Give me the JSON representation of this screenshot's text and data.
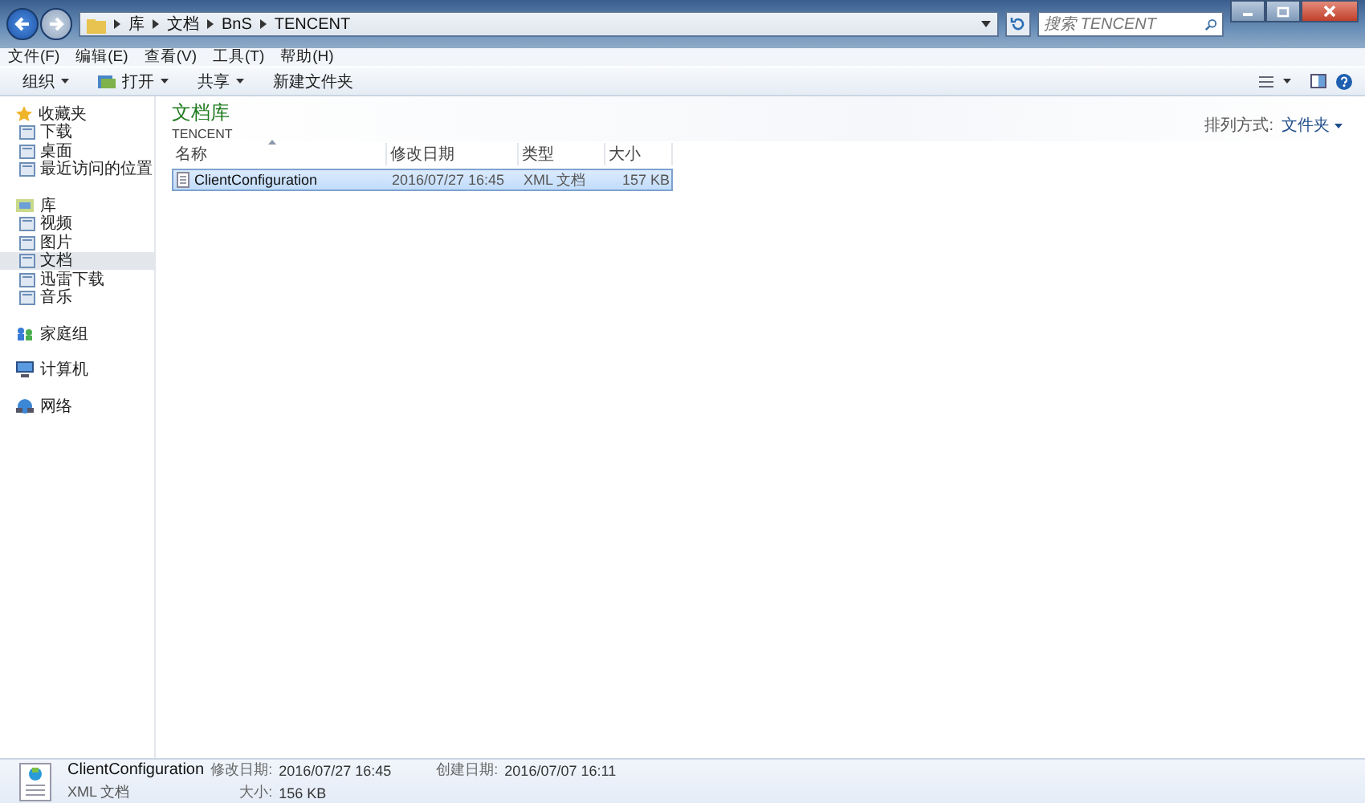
{
  "window": {
    "breadcrumb": [
      "库",
      "文档",
      "BnS",
      "TENCENT"
    ],
    "search": {
      "placeholder": "搜索 TENCENT"
    }
  },
  "menu": [
    "文件(F)",
    "编辑(E)",
    "查看(V)",
    "工具(T)",
    "帮助(H)"
  ],
  "toolbar": [
    {
      "label": "组织",
      "dropdown": true,
      "kind": "plain"
    },
    {
      "label": "打开",
      "dropdown": true,
      "kind": "open"
    },
    {
      "label": "共享",
      "dropdown": true,
      "kind": "plain"
    },
    {
      "label": "新建文件夹",
      "dropdown": false,
      "kind": "plain"
    }
  ],
  "sidebar": [
    {
      "label": "收藏夹",
      "kind": "star",
      "children": [
        {
          "label": "下载",
          "selected": false
        },
        {
          "label": "桌面",
          "selected": false
        },
        {
          "label": "最近访问的位置",
          "selected": false
        }
      ]
    },
    {
      "label": "库",
      "kind": "library",
      "children": [
        {
          "label": "视频",
          "selected": false
        },
        {
          "label": "图片",
          "selected": false
        },
        {
          "label": "文档",
          "selected": true
        },
        {
          "label": "迅雷下载",
          "selected": false
        },
        {
          "label": "音乐",
          "selected": false
        }
      ]
    },
    {
      "label": "家庭组",
      "kind": "homegroup"
    },
    {
      "label": "计算机",
      "kind": "computer"
    },
    {
      "label": "网络",
      "kind": "network"
    }
  ],
  "library": {
    "title": "文档库",
    "subtitle": "TENCENT",
    "arrange_label": "排列方式:",
    "arrange_value": "文件夹"
  },
  "table": {
    "columns": [
      "名称",
      "修改日期",
      "类型",
      "大小"
    ],
    "rows": [
      {
        "cells": [
          "ClientConfiguration",
          "2016/07/27 16:45",
          "XML 文档",
          "157 KB"
        ],
        "selected": true
      }
    ]
  },
  "details": {
    "name": "ClientConfiguration",
    "type": "XML 文档",
    "fields": [
      {
        "label": "修改日期:",
        "value": "2016/07/27 16:45"
      },
      {
        "label": "创建日期:",
        "value": "2016/07/07 16:11"
      },
      {
        "label": "大小:",
        "value": "156 KB"
      }
    ]
  }
}
